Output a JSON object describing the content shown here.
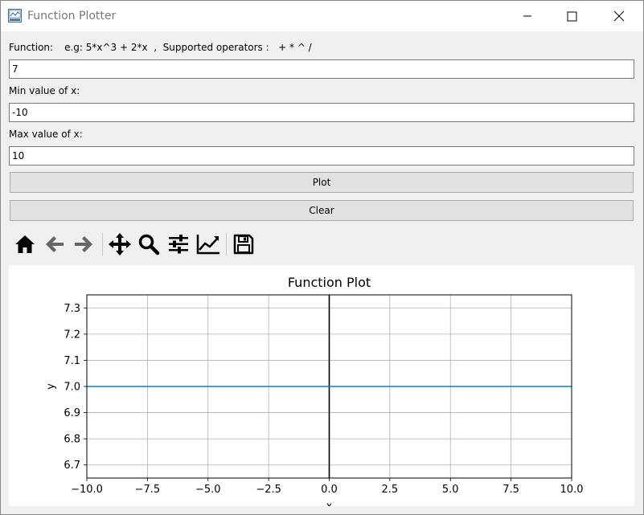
{
  "window": {
    "title": "Function Plotter"
  },
  "form": {
    "function_label": "Function:",
    "function_hint": "e.g: 5*x^3 + 2*x  ,  Supported operators :   + * ^ /",
    "function_value": "7",
    "min_label": "Min value of x:",
    "min_value": "-10",
    "max_label": "Max value of x:",
    "max_value": "10"
  },
  "buttons": {
    "plot": "Plot",
    "clear": "Clear"
  },
  "toolbar": {
    "icons": [
      "home-icon",
      "back-arrow-icon",
      "forward-arrow-icon",
      "pan-icon",
      "zoom-icon",
      "configure-subplots-icon",
      "edit-axis-icon",
      "save-icon"
    ]
  },
  "colors": {
    "line": "#1f77b4",
    "grid": "#b0b0b0",
    "axis_line": "#000000"
  },
  "chart_data": {
    "type": "line",
    "title": "Function Plot",
    "xlabel": "x",
    "ylabel": "y",
    "xlim": [
      -10,
      10
    ],
    "ylim": [
      6.65,
      7.35
    ],
    "x_ticks": [
      -10.0,
      -7.5,
      -5.0,
      -2.5,
      0.0,
      2.5,
      5.0,
      7.5,
      10.0
    ],
    "x_tick_labels": [
      "−10.0",
      "−7.5",
      "−5.0",
      "−2.5",
      "0.0",
      "2.5",
      "5.0",
      "7.5",
      "10.0"
    ],
    "y_ticks": [
      6.7,
      6.8,
      6.9,
      7.0,
      7.1,
      7.2,
      7.3
    ],
    "y_tick_labels": [
      "6.7",
      "6.8",
      "6.9",
      "7.0",
      "7.1",
      "7.2",
      "7.3"
    ],
    "grid": true,
    "series": [
      {
        "x": [
          -10,
          10
        ],
        "y": [
          7,
          7
        ]
      }
    ],
    "vertical_line_x": 0
  }
}
